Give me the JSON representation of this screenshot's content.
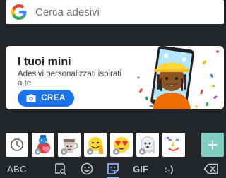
{
  "search": {
    "placeholder": "Cerca adesivi",
    "icon": "google-g-icon"
  },
  "promo_card": {
    "title": "I tuoi mini",
    "description": "Adesivi personalizzati ispirati a te",
    "button_label": "CREA",
    "button_icon": "camera-icon"
  },
  "sticker_strip": {
    "recent_icon": "clock-icon",
    "stickers": [
      {
        "name": "red-bird-sticker",
        "animated": true
      },
      {
        "name": "coffee-cup-sticker",
        "animated": true
      },
      {
        "name": "thumbs-up-sticker",
        "animated": true
      },
      {
        "name": "heart-eyes-sticker",
        "animated": true
      },
      {
        "name": "ghost-sticker",
        "animated": true
      },
      {
        "name": "doodle-face-sticker",
        "animated": false
      }
    ],
    "add_label": "+"
  },
  "bottom_bar": {
    "abc_label": "ABC",
    "gif_label": "GIF",
    "emoticon_label": ":-)",
    "active_tab": "stickers"
  },
  "colors": {
    "accent": "#1a73e8",
    "add_button": "#7fcdc0",
    "background": "#232629"
  }
}
